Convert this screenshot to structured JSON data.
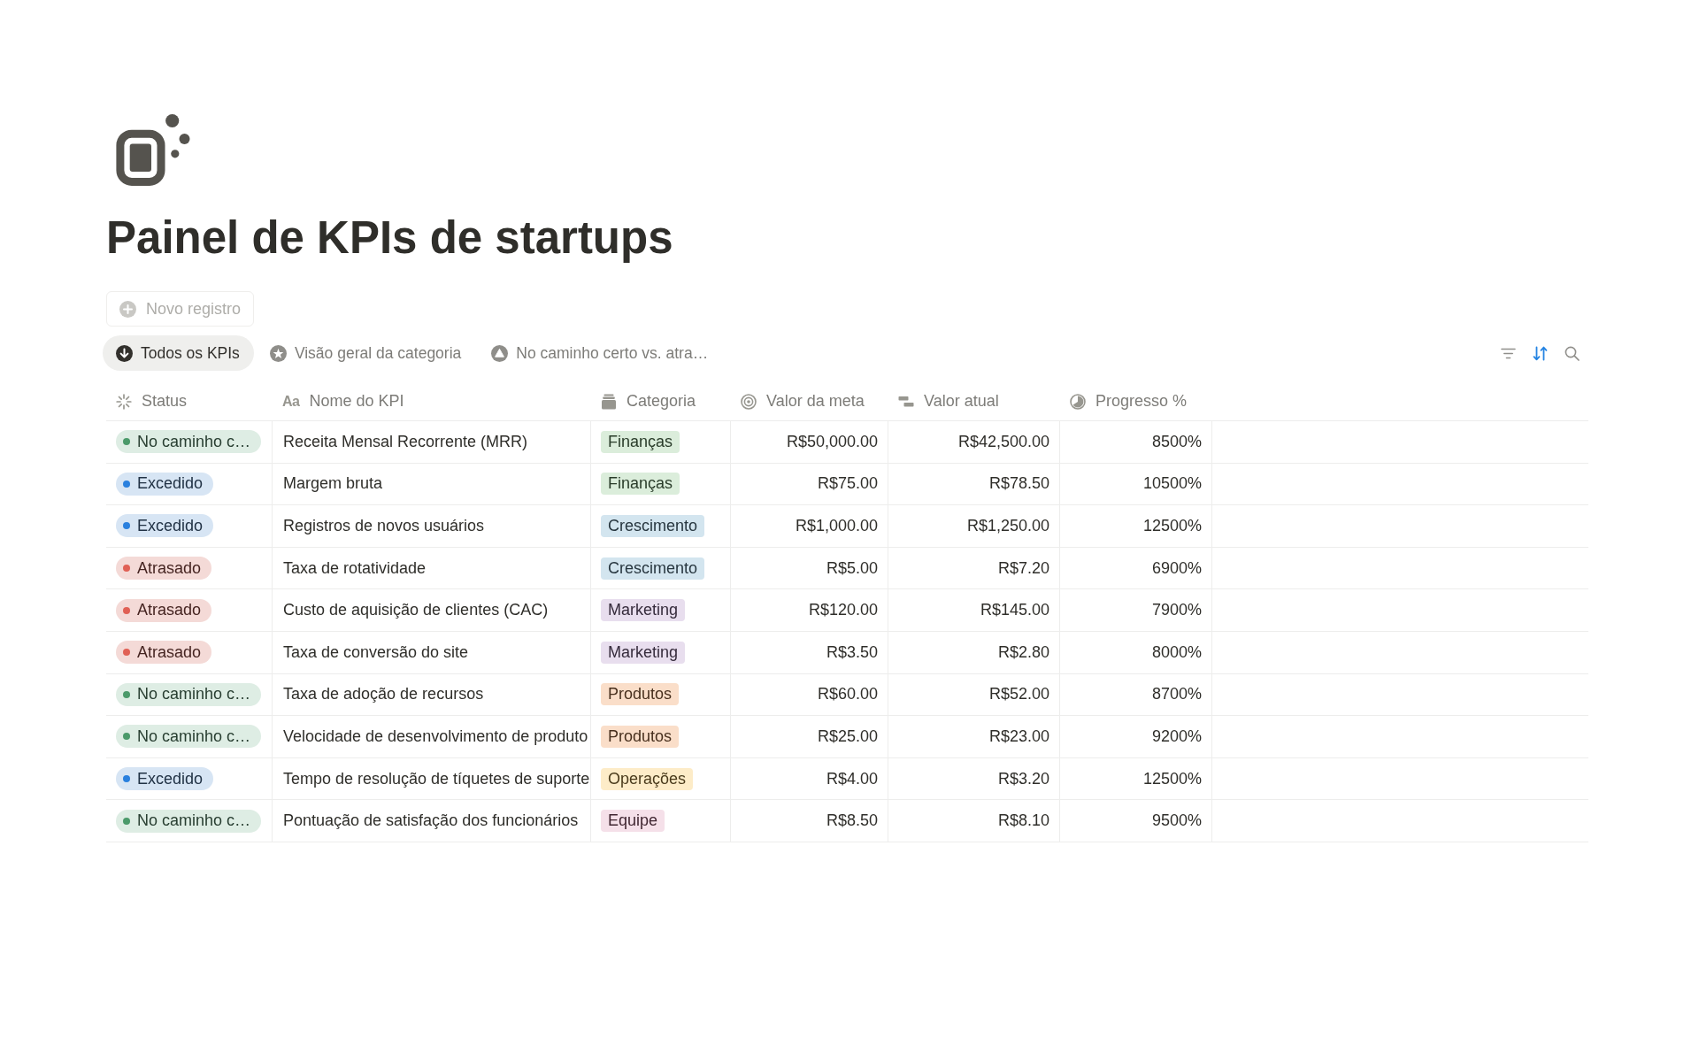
{
  "page": {
    "title": "Painel de KPIs de startups",
    "new_record": "Novo registro"
  },
  "views": [
    {
      "label": "Todos os KPIs",
      "kind": "arrow",
      "selected": true
    },
    {
      "label": "Visão geral da categoria",
      "kind": "star",
      "selected": false
    },
    {
      "label": "No caminho certo vs. atra…",
      "kind": "triangle",
      "selected": false
    }
  ],
  "toolbar": [
    {
      "kind": "filter",
      "active": false
    },
    {
      "kind": "sort",
      "active": true
    },
    {
      "kind": "search",
      "active": false
    }
  ],
  "table": {
    "columns": [
      {
        "label": "Status",
        "kind": "status"
      },
      {
        "label": "Nome do KPI",
        "kind": "title",
        "icon_text": "Aa"
      },
      {
        "label": "Categoria",
        "kind": "select"
      },
      {
        "label": "Valor da meta",
        "kind": "goal"
      },
      {
        "label": "Valor atual",
        "kind": "number"
      },
      {
        "label": "Progresso %",
        "kind": "formula"
      }
    ],
    "rows": [
      {
        "status": {
          "label": "No caminho c…",
          "color": "#4b9a6a"
        },
        "name": "Receita Mensal Recorrente (MRR)",
        "category": {
          "label": "Finanças",
          "color": "#dbeddb"
        },
        "goal": "R$50,000.00",
        "current": "R$42,500.00",
        "progress": "8500%"
      },
      {
        "status": {
          "label": "Excedido",
          "color": "#2a80de"
        },
        "name": "Margem bruta",
        "category": {
          "label": "Finanças",
          "color": "#dbeddb"
        },
        "goal": "R$75.00",
        "current": "R$78.50",
        "progress": "10500%"
      },
      {
        "status": {
          "label": "Excedido",
          "color": "#2a80de"
        },
        "name": "Registros de novos usuários",
        "category": {
          "label": "Crescimento",
          "color": "#d3e5ef"
        },
        "goal": "R$1,000.00",
        "current": "R$1,250.00",
        "progress": "12500%"
      },
      {
        "status": {
          "label": "Atrasado",
          "color": "#e06055"
        },
        "name": "Taxa de rotatividade",
        "category": {
          "label": "Crescimento",
          "color": "#d3e5ef"
        },
        "goal": "R$5.00",
        "current": "R$7.20",
        "progress": "6900%"
      },
      {
        "status": {
          "label": "Atrasado",
          "color": "#e06055"
        },
        "name": "Custo de aquisição de clientes (CAC)",
        "category": {
          "label": "Marketing",
          "color": "#e8deee"
        },
        "goal": "R$120.00",
        "current": "R$145.00",
        "progress": "7900%"
      },
      {
        "status": {
          "label": "Atrasado",
          "color": "#e06055"
        },
        "name": "Taxa de conversão do site",
        "category": {
          "label": "Marketing",
          "color": "#e8deee"
        },
        "goal": "R$3.50",
        "current": "R$2.80",
        "progress": "8000%"
      },
      {
        "status": {
          "label": "No caminho c…",
          "color": "#4b9a6a"
        },
        "name": "Taxa de adoção de recursos",
        "category": {
          "label": "Produtos",
          "color": "#fadec9"
        },
        "goal": "R$60.00",
        "current": "R$52.00",
        "progress": "8700%"
      },
      {
        "status": {
          "label": "No caminho c…",
          "color": "#4b9a6a"
        },
        "name": "Velocidade de desenvolvimento de produto",
        "category": {
          "label": "Produtos",
          "color": "#fadec9"
        },
        "goal": "R$25.00",
        "current": "R$23.00",
        "progress": "9200%"
      },
      {
        "status": {
          "label": "Excedido",
          "color": "#2a80de"
        },
        "name": "Tempo de resolução de tíquetes de suporte",
        "category": {
          "label": "Operações",
          "color": "#fdecc8"
        },
        "goal": "R$4.00",
        "current": "R$3.20",
        "progress": "12500%"
      },
      {
        "status": {
          "label": "No caminho c…",
          "color": "#4b9a6a"
        },
        "name": "Pontuação de satisfação dos funcionários",
        "category": {
          "label": "Equipe",
          "color": "#f5e0e9"
        },
        "goal": "R$8.50",
        "current": "R$8.10",
        "progress": "9500%"
      }
    ]
  }
}
